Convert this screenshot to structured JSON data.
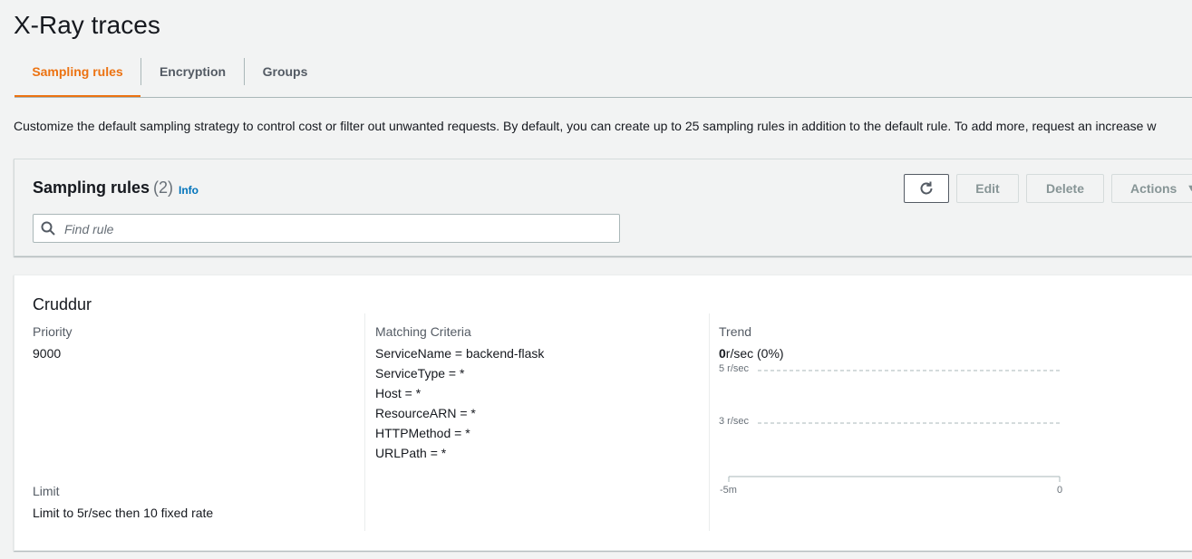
{
  "page": {
    "title": "X-Ray traces"
  },
  "tabs": [
    {
      "label": "Sampling rules",
      "active": true
    },
    {
      "label": "Encryption",
      "active": false
    },
    {
      "label": "Groups",
      "active": false
    }
  ],
  "description": "Customize the default sampling strategy to control cost or filter out unwanted requests. By default, you can create up to 25 sampling rules in addition to the default rule. To add more, request an increase w",
  "sampling_rules": {
    "title": "Sampling rules",
    "count": "(2)",
    "info_label": "Info",
    "buttons": {
      "edit": "Edit",
      "delete": "Delete",
      "actions": "Actions"
    },
    "search": {
      "placeholder": "Find rule",
      "value": ""
    }
  },
  "rule": {
    "name": "Cruddur",
    "priority_label": "Priority",
    "priority": "9000",
    "limit_label": "Limit",
    "limit": "Limit to 5r/sec then 10 fixed rate",
    "criteria_label": "Matching Criteria",
    "criteria": [
      "ServiceName = backend-flask",
      "ServiceType = *",
      "Host = *",
      "ResourceARN = *",
      "HTTPMethod = *",
      "URLPath = *"
    ],
    "trend_label": "Trend",
    "trend_value_num": "0",
    "trend_value_suffix": "r/sec (0%)"
  },
  "chart_data": {
    "type": "line",
    "y_ticks": [
      "5 r/sec",
      "3 r/sec"
    ],
    "x_ticks": [
      "-5m",
      "0"
    ],
    "series": [],
    "grid": "dashed"
  },
  "colors": {
    "accent": "#ec7211",
    "link": "#0073bb",
    "background": "#f2f3f3"
  },
  "icons": {
    "refresh": "refresh-icon",
    "search": "search-icon",
    "actions": "caret-down-icon"
  }
}
